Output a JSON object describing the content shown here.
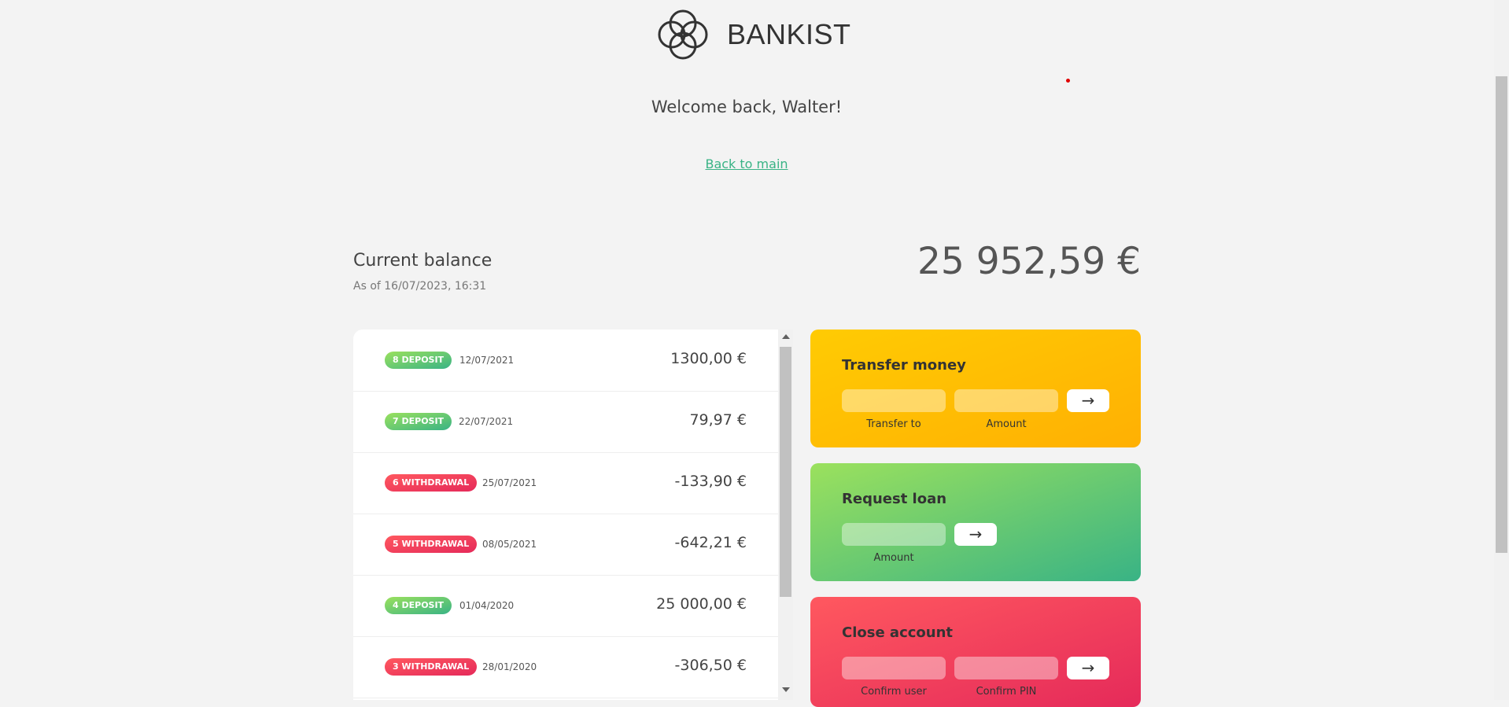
{
  "brand": {
    "name": "BANKIST"
  },
  "welcome": "Welcome back, Walter!",
  "back_link": "Back to main",
  "balance": {
    "label": "Current balance",
    "date": "As of 16/07/2023, 16:31",
    "value": "25 952,59 €"
  },
  "movements": [
    {
      "type_label": "8 DEPOSIT",
      "kind": "deposit",
      "date": "12/07/2021",
      "value": "1300,00 €"
    },
    {
      "type_label": "7 DEPOSIT",
      "kind": "deposit",
      "date": "22/07/2021",
      "value": "79,97 €"
    },
    {
      "type_label": "6 WITHDRAWAL",
      "kind": "withdrawal",
      "date": "25/07/2021",
      "value": "-133,90 €"
    },
    {
      "type_label": "5 WITHDRAWAL",
      "kind": "withdrawal",
      "date": "08/05/2021",
      "value": "-642,21 €"
    },
    {
      "type_label": "4 DEPOSIT",
      "kind": "deposit",
      "date": "01/04/2020",
      "value": "25 000,00 €"
    },
    {
      "type_label": "3 WITHDRAWAL",
      "kind": "withdrawal",
      "date": "28/01/2020",
      "value": "-306,50 €"
    }
  ],
  "operations": {
    "transfer": {
      "title": "Transfer money",
      "label_to": "Transfer to",
      "label_amount": "Amount",
      "button": "→"
    },
    "loan": {
      "title": "Request loan",
      "label_amount": "Amount",
      "button": "→"
    },
    "close": {
      "title": "Close account",
      "label_user": "Confirm user",
      "label_pin": "Confirm PIN",
      "button": "→"
    }
  },
  "colors": {
    "deposit": "#39b385",
    "withdrawal": "#e52a5a",
    "transfer": "#ffb003",
    "loan": "#9be15d",
    "close": "#ff585f",
    "link": "#39b385"
  },
  "icons": {
    "logo": "bankist-logo-icon",
    "submit": "arrow-right-icon"
  }
}
